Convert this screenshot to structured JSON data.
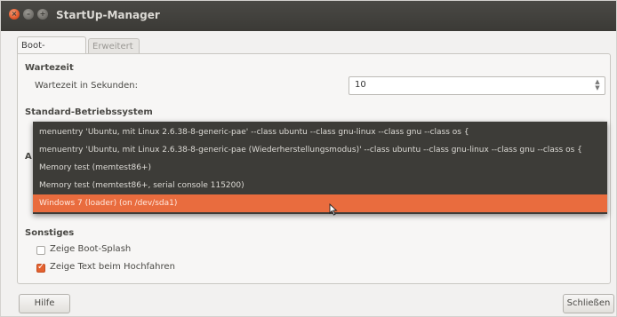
{
  "window": {
    "title": "StartUp-Manager"
  },
  "tabs": [
    {
      "label": "Boot-Optionen",
      "active": true
    },
    {
      "label": "Erweitert",
      "active": false
    }
  ],
  "wartezeit": {
    "heading": "Wartezeit",
    "label": "Wartezeit in Sekunden:",
    "value": "10"
  },
  "os": {
    "heading": "Standard-Betriebssystem",
    "options": [
      "menuentry 'Ubuntu, mit Linux 2.6.38-8-generic-pae' --class ubuntu --class gnu-linux --class gnu --class os {",
      "menuentry 'Ubuntu, mit Linux 2.6.38-8-generic-pae (Wiederherstellungsmodus)' --class ubuntu --class gnu-linux --class gnu --class os {",
      "Memory test (memtest86+)",
      "Memory test (memtest86+, serial console 115200)",
      "Windows 7 (loader) (on /dev/sda1)"
    ],
    "selected_index": 4
  },
  "hidden_section_letter": "A",
  "sonstiges": {
    "heading": "Sonstiges",
    "items": [
      {
        "label": "Zeige Boot-Splash",
        "checked": false
      },
      {
        "label": "Zeige Text beim Hochfahren",
        "checked": true
      }
    ]
  },
  "buttons": {
    "help": "Hilfe",
    "close": "Schließen"
  },
  "colors": {
    "accent": "#e96c3e",
    "menu_bg": "#3d3c38",
    "titlebar": "#3b3a36"
  }
}
